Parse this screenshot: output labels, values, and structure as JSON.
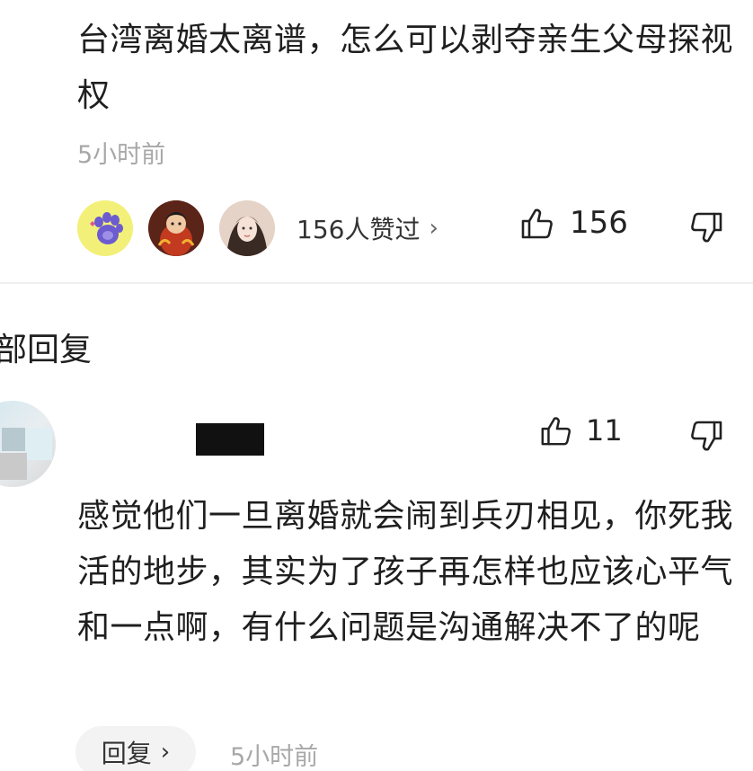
{
  "comment": {
    "text": "台湾离婚太离谱，怎么可以剥夺亲生父母探视权",
    "time": "5小时前",
    "liked_by_label": "156人赞过",
    "like_count": "156"
  },
  "replies_section": {
    "title": "部回复"
  },
  "reply": {
    "like_count": "11",
    "text": "感觉他们一旦离婚就会闹到兵刃相见，你死我活的地步，其实为了孩子再怎样也应该心平气和一点啊，有什么问题是沟通解决不了的呢",
    "reply_button_label": "回复",
    "time": "5小时前"
  },
  "icons": {
    "like": "thumbs-up-icon",
    "dislike": "thumbs-down-icon",
    "chevron": "chevron-right-icon"
  },
  "colors": {
    "text": "#1f1f1f",
    "muted": "#a8a8a8",
    "divider": "#efefef",
    "reply_button_bg": "#f3f3f3"
  }
}
